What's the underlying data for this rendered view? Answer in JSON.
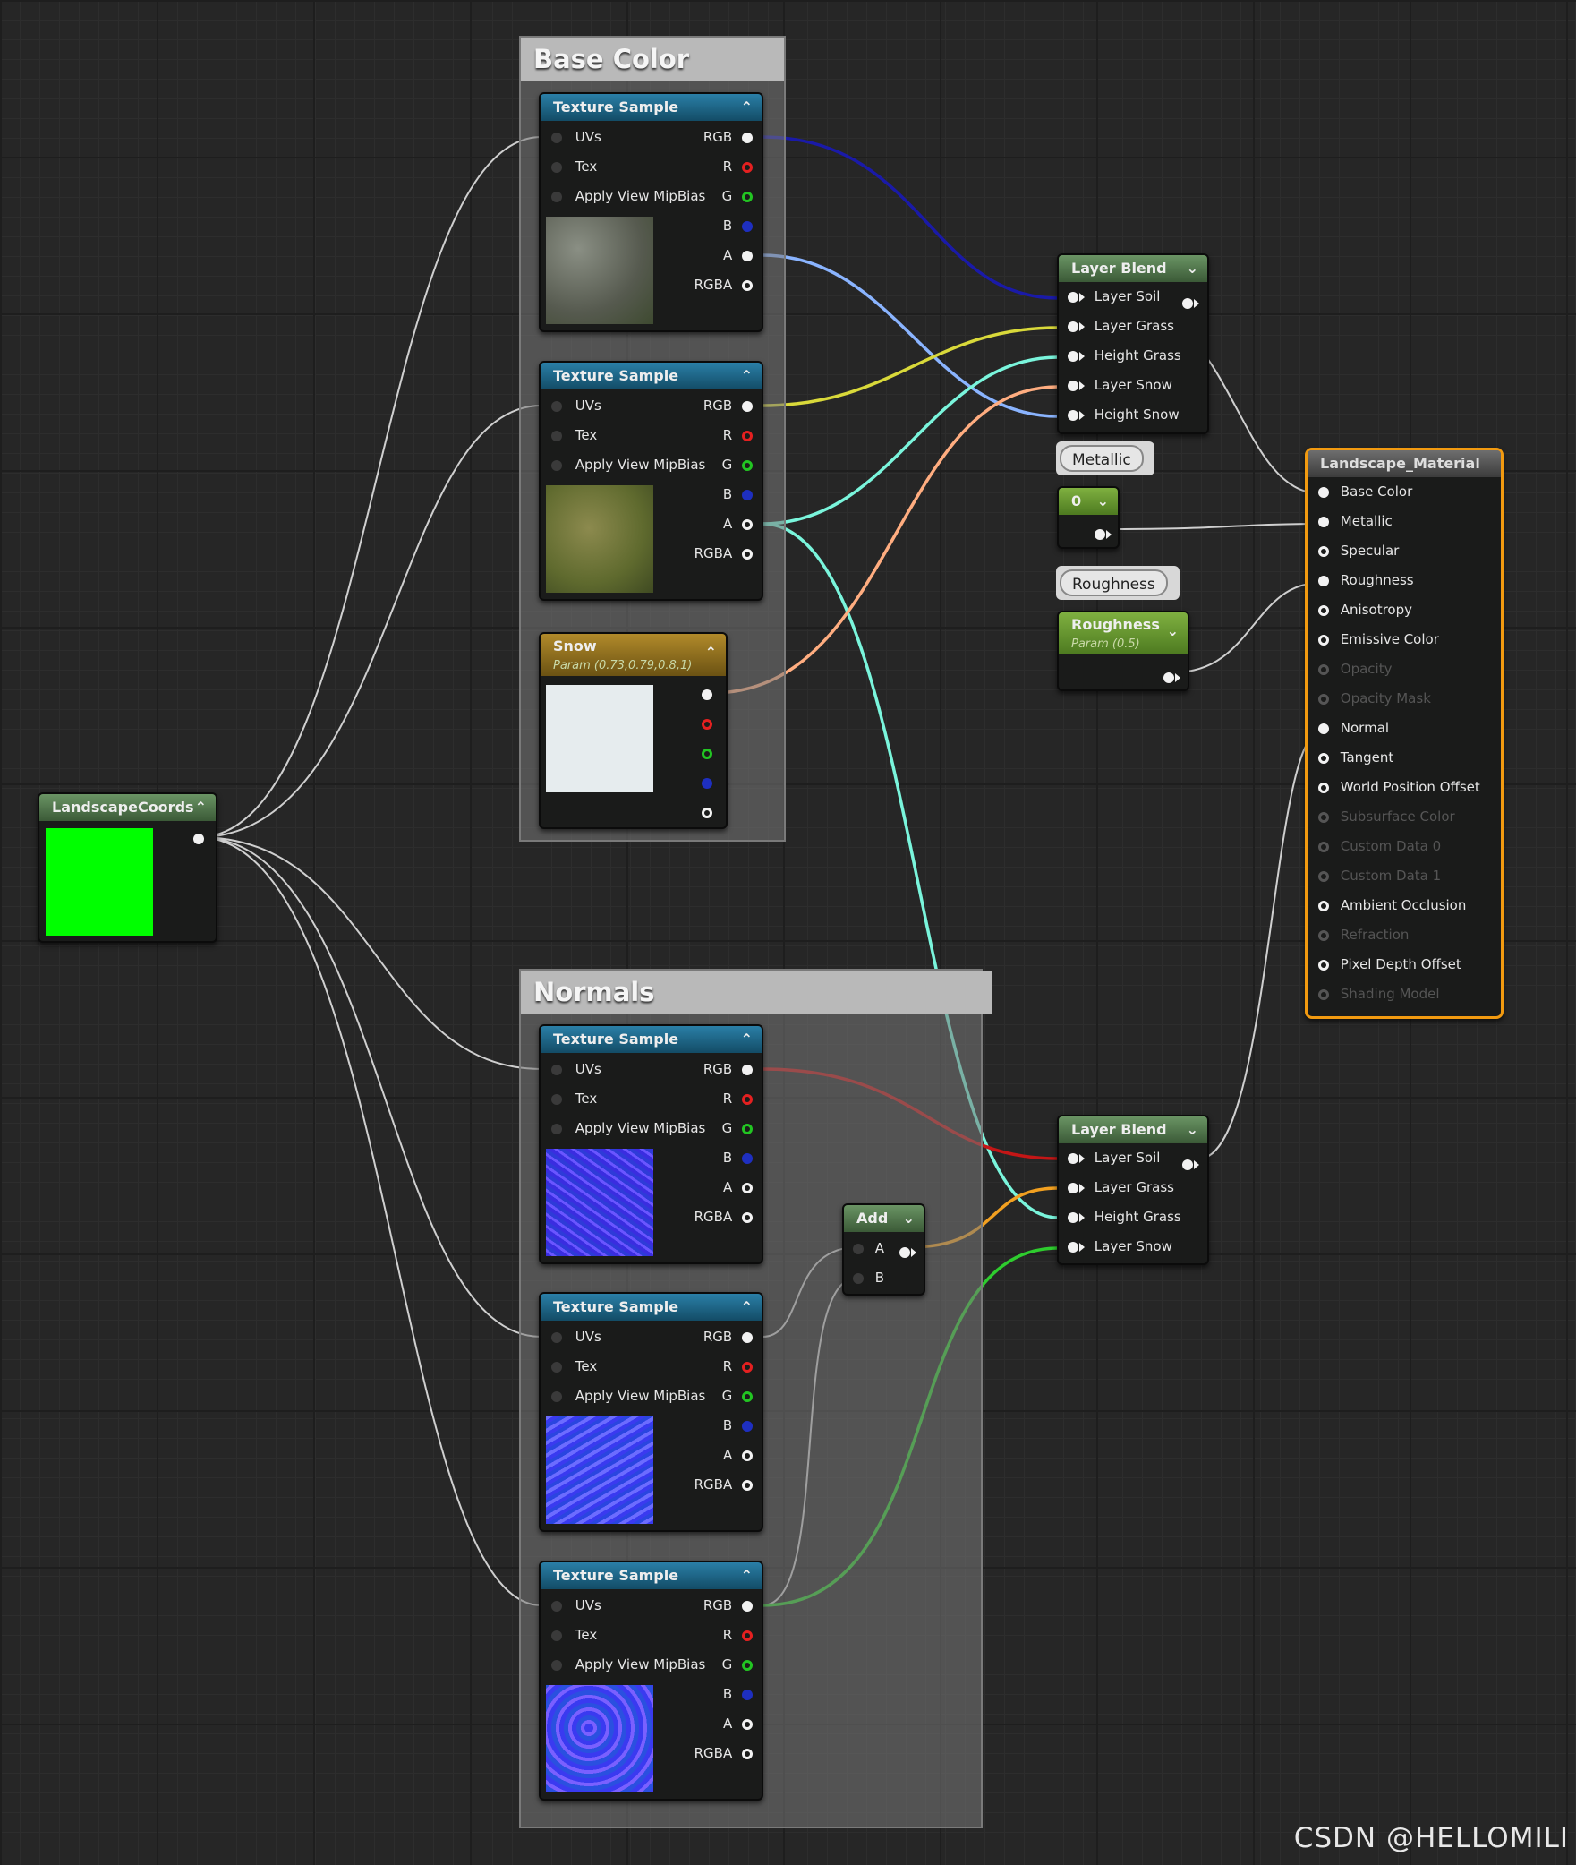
{
  "comments": {
    "base_color": "Base Color",
    "normals": "Normals"
  },
  "texture_sample": {
    "title": "Texture Sample",
    "inputs": [
      "UVs",
      "Tex",
      "Apply View MipBias"
    ],
    "outputs": [
      "RGB",
      "R",
      "G",
      "B",
      "A",
      "RGBA"
    ]
  },
  "snow_node": {
    "title": "Snow",
    "subtitle": "Param (0.73,0.79,0.8,1)"
  },
  "landscape_coords": {
    "title": "LandscapeCoords"
  },
  "layer_blend_top": {
    "title": "Layer Blend",
    "inputs": [
      "Layer Soil",
      "Layer Grass",
      "Height Grass",
      "Layer Snow",
      "Height Snow"
    ]
  },
  "layer_blend_bottom": {
    "title": "Layer Blend",
    "inputs": [
      "Layer Soil",
      "Layer Grass",
      "Height Grass",
      "Layer Snow"
    ]
  },
  "metallic_comment": "Metallic",
  "metallic_const": "0",
  "roughness_comment": "Roughness",
  "roughness_param": {
    "title": "Roughness",
    "subtitle": "Param (0.5)"
  },
  "add_node": {
    "title": "Add",
    "inputs": [
      "A",
      "B"
    ]
  },
  "material": {
    "title": "Landscape_Material",
    "pins": [
      {
        "label": "Base Color",
        "active": true,
        "filled": true
      },
      {
        "label": "Metallic",
        "active": true,
        "filled": true
      },
      {
        "label": "Specular",
        "active": true,
        "filled": false
      },
      {
        "label": "Roughness",
        "active": true,
        "filled": true
      },
      {
        "label": "Anisotropy",
        "active": true,
        "filled": false
      },
      {
        "label": "Emissive Color",
        "active": true,
        "filled": false
      },
      {
        "label": "Opacity",
        "active": false,
        "filled": false
      },
      {
        "label": "Opacity Mask",
        "active": false,
        "filled": false
      },
      {
        "label": "Normal",
        "active": true,
        "filled": true
      },
      {
        "label": "Tangent",
        "active": true,
        "filled": false
      },
      {
        "label": "World Position Offset",
        "active": true,
        "filled": false
      },
      {
        "label": "Subsurface Color",
        "active": false,
        "filled": false
      },
      {
        "label": "Custom Data 0",
        "active": false,
        "filled": false
      },
      {
        "label": "Custom Data 1",
        "active": false,
        "filled": false
      },
      {
        "label": "Ambient Occlusion",
        "active": true,
        "filled": false
      },
      {
        "label": "Refraction",
        "active": false,
        "filled": false
      },
      {
        "label": "Pixel Depth Offset",
        "active": true,
        "filled": false
      },
      {
        "label": "Shading Model",
        "active": false,
        "filled": false
      }
    ]
  },
  "watermark": "CSDN @HELLOMILI",
  "colors": {
    "wire_white": "#d0d0d0",
    "wire_navy": "#1a1aa8",
    "wire_lightblue": "#8ab4ff",
    "wire_yellow": "#d9d93a",
    "wire_cyan": "#7af5dc",
    "wire_peach": "#ffad80",
    "wire_red": "#c41616",
    "wire_orange": "#f2a020",
    "wire_green": "#2ecc2e",
    "material_border": "#f29a10"
  }
}
